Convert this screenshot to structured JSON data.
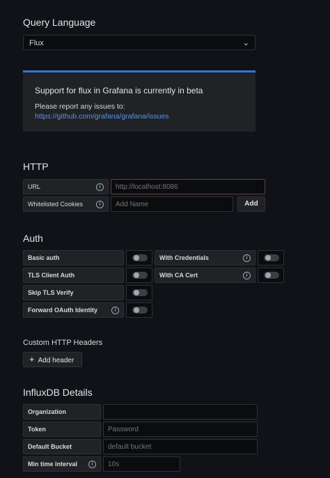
{
  "query_language": {
    "title": "Query Language",
    "selected": "Flux"
  },
  "beta_alert": {
    "title": "Support for flux in Grafana is currently in beta",
    "text": "Please report any issues to:",
    "link": "https://github.com/grafana/grafana/issues",
    "accent_color": "#3274d9"
  },
  "http": {
    "title": "HTTP",
    "url_label": "URL",
    "url_placeholder": "http://localhost:8086",
    "cookies_label": "Whitelisted Cookies",
    "cookies_placeholder": "Add Name",
    "add_button": "Add"
  },
  "auth": {
    "title": "Auth",
    "basic_auth": "Basic auth",
    "with_credentials": "With Credentials",
    "tls_client_auth": "TLS Client Auth",
    "with_ca_cert": "With CA Cert",
    "skip_tls_verify": "Skip TLS Verify",
    "forward_oauth": "Forward OAuth Identity"
  },
  "custom_headers": {
    "title": "Custom HTTP Headers",
    "add_header": "Add header"
  },
  "influxdb": {
    "title": "InfluxDB Details",
    "organization_label": "Organization",
    "organization_value": "",
    "token_label": "Token",
    "token_placeholder": "Password",
    "bucket_label": "Default Bucket",
    "bucket_placeholder": "default bucket",
    "interval_label": "Min time interval",
    "interval_placeholder": "10s"
  }
}
